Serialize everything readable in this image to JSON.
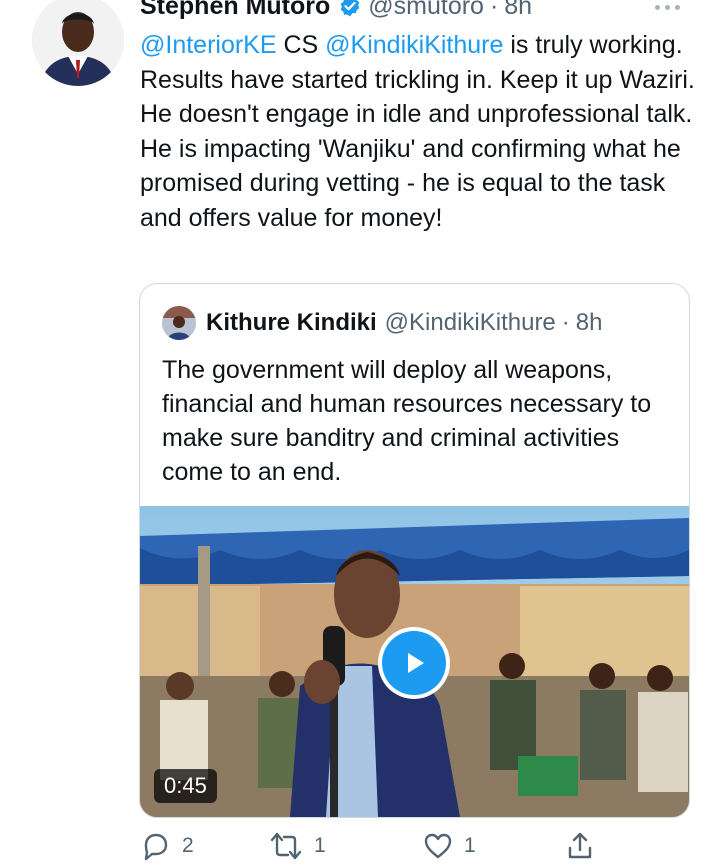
{
  "tweet": {
    "author": {
      "name": "Stephen Mutoro",
      "handle": "@smutoro",
      "separator": "·",
      "time": "8h"
    },
    "text_parts": [
      {
        "text": "@InteriorKE",
        "type": "mention"
      },
      {
        "text": " CS ",
        "type": "text"
      },
      {
        "text": "@KindikiKithure",
        "type": "mention"
      },
      {
        "text": " is truly working. Results have started trickling in. Keep it up Waziri. He doesn't engage in idle and unprofessional talk. He is impacting 'Wanjiku' and confirming what he promised during vetting - he is equal to the task and offers value for money!",
        "type": "text"
      }
    ],
    "quote": {
      "name": "Kithure Kindiki",
      "handle": "@KindikiKithure",
      "separator": "·",
      "time": "8h",
      "text": "The government will deploy all weapons, financial and human resources necessary to make sure banditry and criminal activities come to an end.",
      "video_duration": "0:45"
    },
    "actions": {
      "replies": "2",
      "retweets": "1",
      "likes": "1"
    }
  },
  "icons": {
    "verified": "verified-badge-icon",
    "more": "more-options-icon",
    "reply": "reply-icon",
    "retweet": "retweet-icon",
    "like": "heart-icon",
    "share": "share-icon",
    "play": "play-icon"
  },
  "colors": {
    "accent": "#1d9bf0",
    "text": "#0f1419",
    "secondary": "#536471",
    "border": "#cfd9de"
  }
}
